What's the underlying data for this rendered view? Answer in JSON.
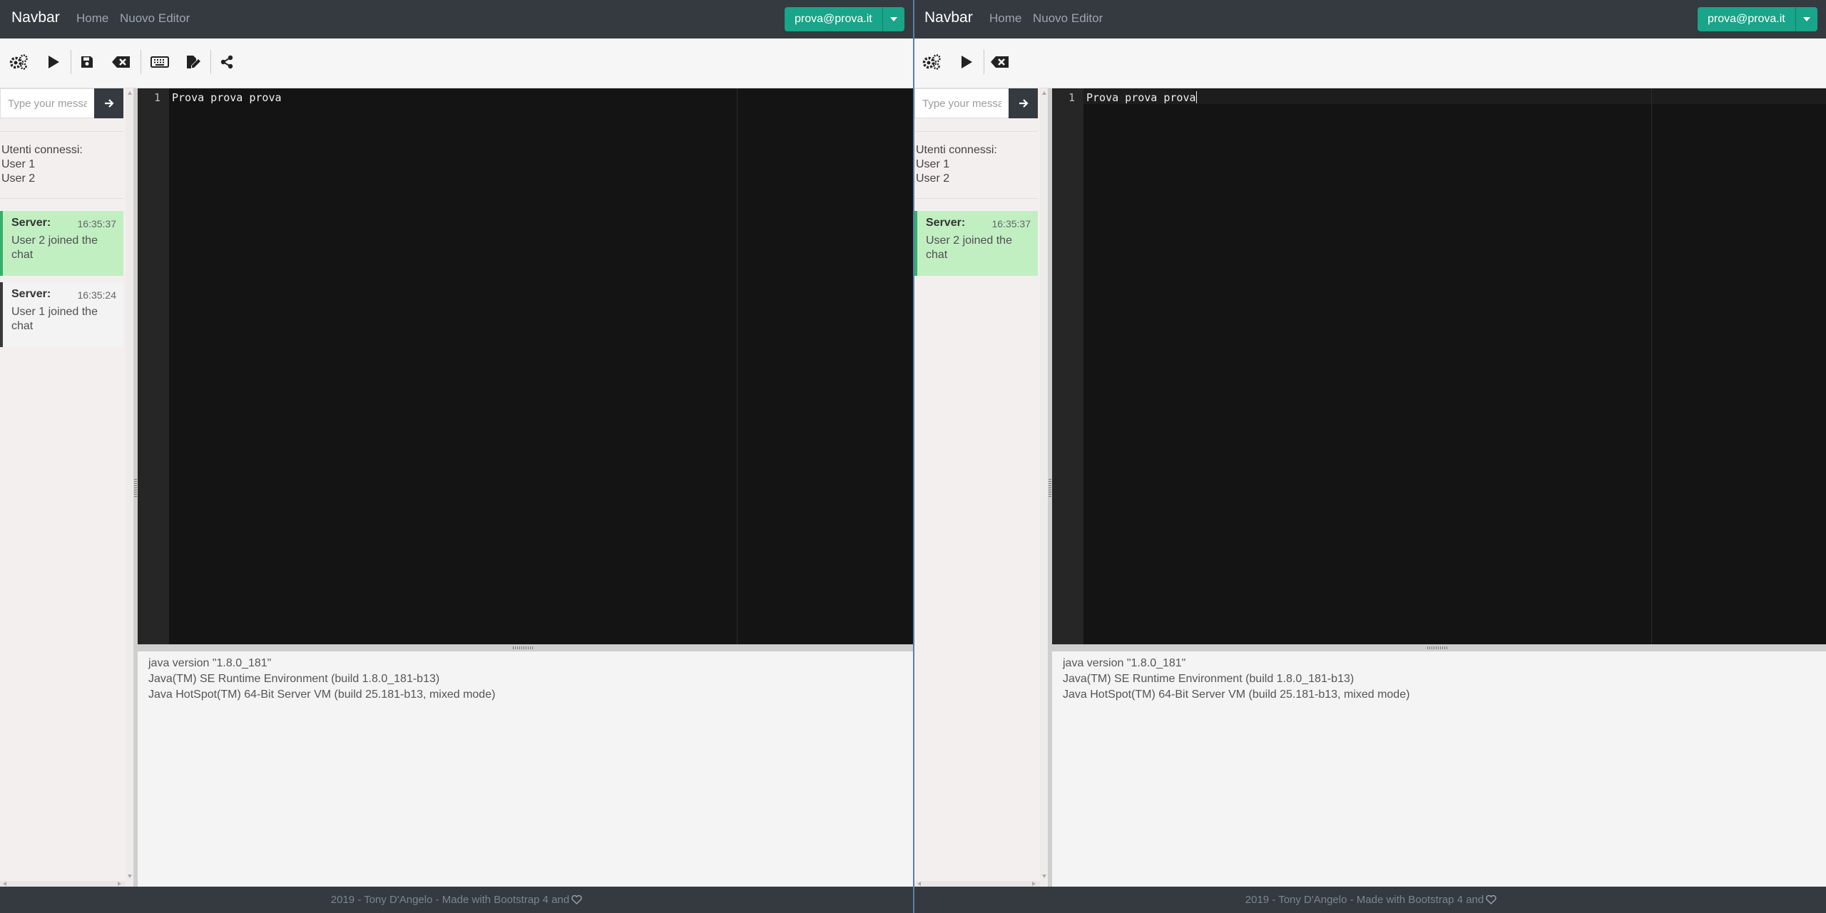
{
  "navbar": {
    "brand": "Navbar",
    "links": [
      "Home",
      "Nuovo Editor"
    ],
    "user_email": "prova@prova.it"
  },
  "toolbar": {
    "icons": [
      "settings-icon",
      "run-icon",
      "save-icon",
      "clear-icon",
      "keyboard-icon",
      "edit-icon",
      "share-icon"
    ]
  },
  "chat": {
    "input_placeholder": "Type your message",
    "connected_label": "Utenti connessi:",
    "connected_users": [
      "User 1",
      "User 2"
    ]
  },
  "left": {
    "messages": [
      {
        "from": "Server:",
        "time": "16:35:37",
        "text": "User 2 joined the chat"
      },
      {
        "from": "Server:",
        "time": "16:35:24",
        "text": "User 1 joined the chat"
      }
    ]
  },
  "right": {
    "messages": [
      {
        "from": "Server:",
        "time": "16:35:37",
        "text": "User 2 joined the chat"
      }
    ]
  },
  "editor": {
    "line_number": "1",
    "code": "Prova prova prova"
  },
  "console": {
    "lines": [
      "java version \"1.8.0_181\"",
      "Java(TM) SE Runtime Environment (build 1.8.0_181-b13)",
      "Java HotSpot(TM) 64-Bit Server VM (build 25.181-b13, mixed mode)"
    ]
  },
  "footer": {
    "text": "2019 - Tony D'Angelo - Made with Bootstrap 4 and"
  },
  "colors": {
    "navbar_bg": "#343a40",
    "accent_green": "#18a589",
    "message_server_bg": "#c1efc2",
    "editor_bg": "#141414"
  }
}
